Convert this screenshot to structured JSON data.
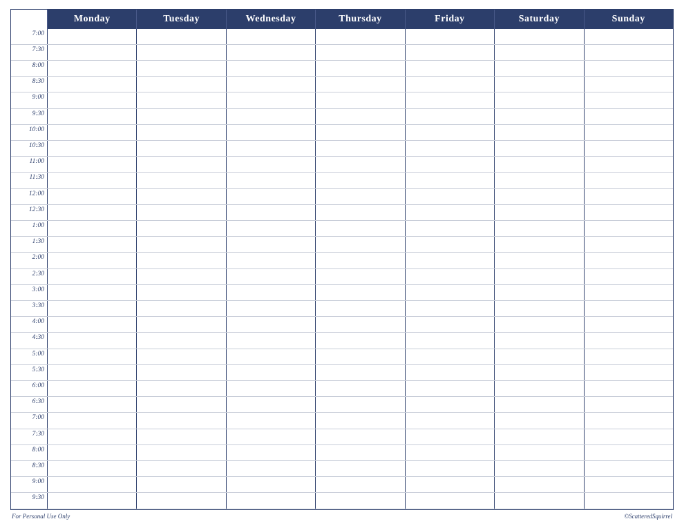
{
  "header": {
    "days": [
      "Monday",
      "Tuesday",
      "Wednesday",
      "Thursday",
      "Friday",
      "Saturday",
      "Sunday"
    ]
  },
  "timeSlots": [
    "7:00",
    "7:30",
    "8:00",
    "8:30",
    "9:00",
    "9:30",
    "10:00",
    "10:30",
    "11:00",
    "11:30",
    "12:00",
    "12:30",
    "1:00",
    "1:30",
    "2:00",
    "2:30",
    "3:00",
    "3:30",
    "4:00",
    "4:30",
    "5:00",
    "5:30",
    "6:00",
    "6:30",
    "7:00",
    "7:30",
    "8:00",
    "8:30",
    "9:00",
    "9:30"
  ],
  "footer": {
    "left": "For Personal Use Only",
    "right": "©ScatteredSquirrel"
  }
}
